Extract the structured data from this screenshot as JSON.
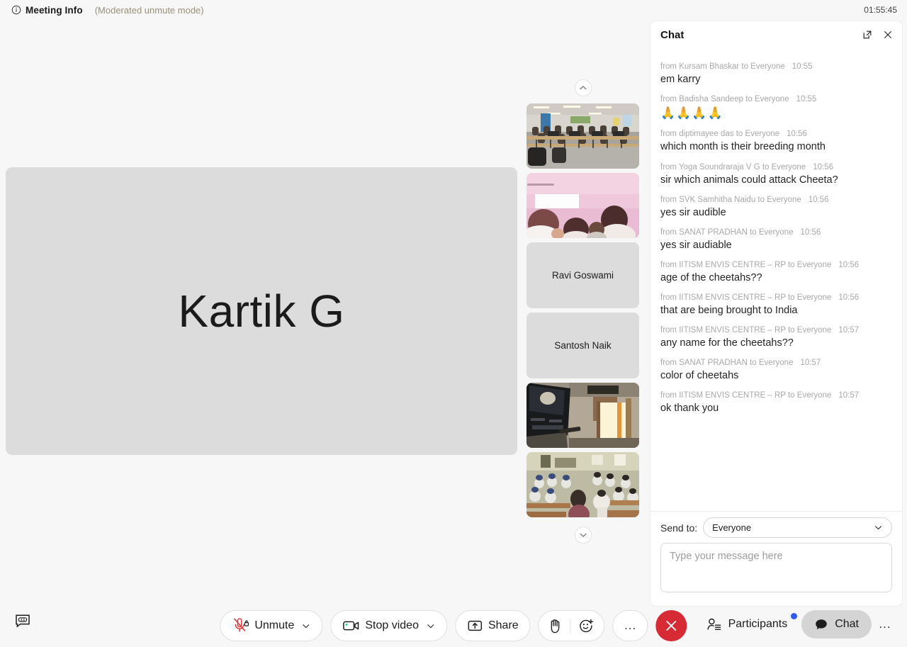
{
  "topbar": {
    "info_icon": "info-circle-icon",
    "meeting_info_label": "Meeting Info",
    "moderated_mode": "(Moderated unmute mode)",
    "clock": "01:55:45",
    "mod_mode_color": "#9a8f78"
  },
  "stage": {
    "active_speaker_name": "Kartik G",
    "tile_color": "#dcdcdc"
  },
  "filmstrip": {
    "scroll_up_icon": "chevron-up-icon",
    "scroll_down_icon": "chevron-down-icon",
    "thumbnails": [
      {
        "kind": "video",
        "scene": "classroom-computers-wide",
        "name": ""
      },
      {
        "kind": "video",
        "scene": "pink-lit-classroom-students",
        "name": ""
      },
      {
        "kind": "name",
        "scene": "",
        "name": "Ravi Goswami"
      },
      {
        "kind": "name",
        "scene": "",
        "name": "Santosh Naik"
      },
      {
        "kind": "video",
        "scene": "projector-screen-window",
        "name": ""
      },
      {
        "kind": "video",
        "scene": "school-classroom-uniforms",
        "name": ""
      }
    ]
  },
  "chat": {
    "title": "Chat",
    "popout_icon": "popout-icon",
    "close_icon": "close-icon",
    "messages": [
      {
        "from": "from Kursam Bhaskar to Everyone",
        "time": "10:55",
        "text": "em karry",
        "is_emoji": false
      },
      {
        "from": "from Badisha Sandeep to Everyone",
        "time": "10:55",
        "text": "🙏🙏🙏🙏",
        "is_emoji": true
      },
      {
        "from": "from diptimayee das to Everyone",
        "time": "10:56",
        "text": "which month is their breeding month",
        "is_emoji": false
      },
      {
        "from": "from Yoga Soundraraja V G to Everyone",
        "time": "10:56",
        "text": "sir which animals could attack Cheeta?",
        "is_emoji": false
      },
      {
        "from": "from SVK Samhitha Naidu to Everyone",
        "time": "10:56",
        "text": "yes sir audible",
        "is_emoji": false
      },
      {
        "from": "from SANAT PRADHAN to Everyone",
        "time": "10:56",
        "text": "yes sir audiable",
        "is_emoji": false
      },
      {
        "from": "from IITISM ENVIS CENTRE – RP to Everyone",
        "time": "10:56",
        "text": "age of the cheetahs??",
        "is_emoji": false
      },
      {
        "from": "from IITISM ENVIS CENTRE – RP to Everyone",
        "time": "10:56",
        "text": "that are being brought to India",
        "is_emoji": false
      },
      {
        "from": "from IITISM ENVIS CENTRE – RP to Everyone",
        "time": "10:57",
        "text": "any name for the cheetahs??",
        "is_emoji": false
      },
      {
        "from": "from SANAT PRADHAN to Everyone",
        "time": "10:57",
        "text": "color of cheetahs",
        "is_emoji": false
      },
      {
        "from": "from IITISM ENVIS CENTRE – RP to Everyone",
        "time": "10:57",
        "text": "ok thank you",
        "is_emoji": false
      }
    ],
    "send_to_label": "Send to:",
    "send_to_value": "Everyone",
    "send_to_caret_icon": "chevron-down-icon",
    "input_placeholder": "Type your message here",
    "input_value": ""
  },
  "toolbar": {
    "cc_icon": "closed-caption-icon",
    "unmute_label": "Unmute",
    "unmute_icon": "microphone-muted-locked-icon",
    "unmute_caret_icon": "chevron-down-icon",
    "stop_video_label": "Stop video",
    "stop_video_icon": "camera-icon",
    "stop_video_caret_icon": "chevron-down-icon",
    "share_label": "Share",
    "share_icon": "share-screen-icon",
    "raise_hand_icon": "raised-hand-icon",
    "reactions_icon": "emoji-plus-icon",
    "more_label": "...",
    "more_icon": "ellipsis-icon",
    "leave_icon": "close-icon",
    "leave_color": "#d62b35",
    "participants_label": "Participants",
    "participants_icon": "participants-icon",
    "participants_badge_color": "#2f5bf0",
    "chat_label": "Chat",
    "chat_icon": "chat-bubble-filled-icon",
    "chat_active": true,
    "right_more_label": "...",
    "right_more_icon": "ellipsis-icon"
  }
}
